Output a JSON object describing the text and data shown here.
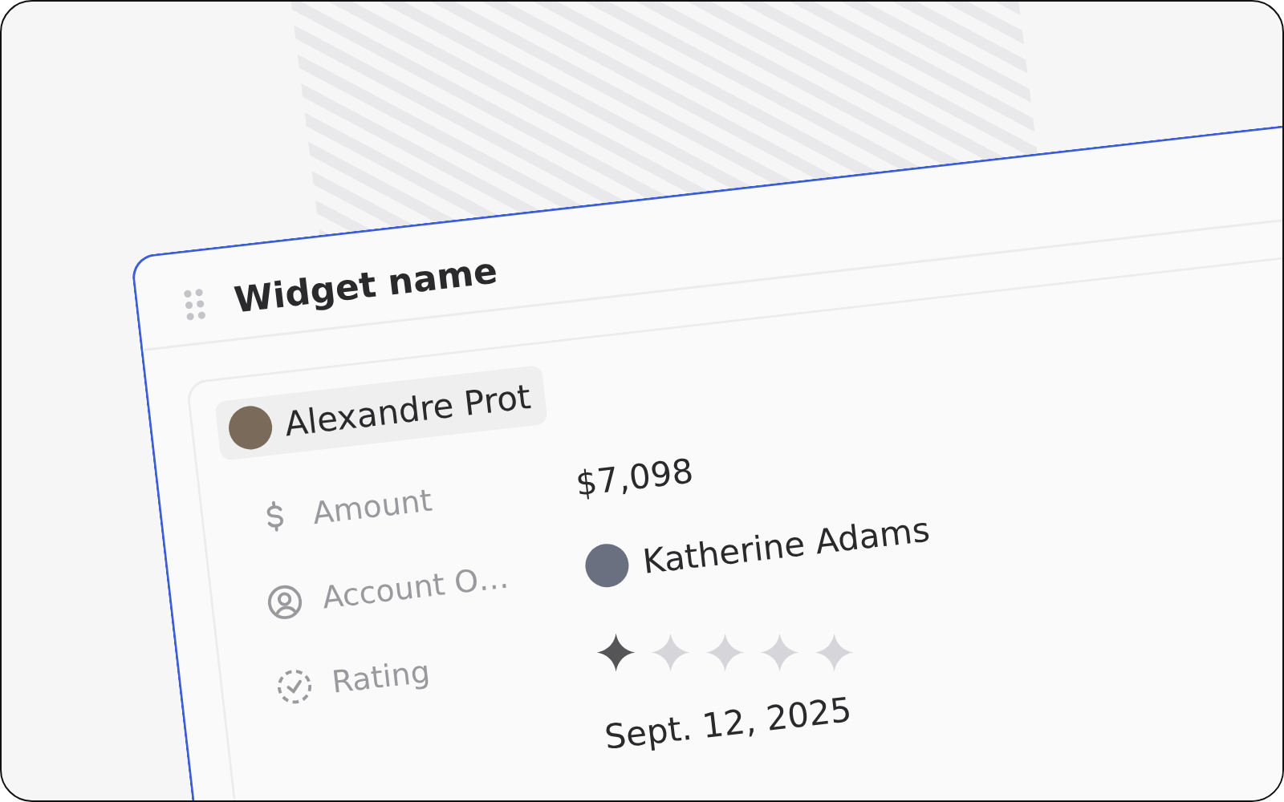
{
  "widget": {
    "title": "Widget name"
  },
  "record": {
    "name": "Alexandre Prot"
  },
  "fields": [
    {
      "kind": "amount",
      "label": "Amount",
      "value": "$7,098"
    },
    {
      "kind": "person",
      "label": "Account O…",
      "value": "Katherine Adams"
    },
    {
      "kind": "rating",
      "label": "Rating",
      "stars": 1
    },
    {
      "kind": "date",
      "value": "Sept. 12, 2025"
    }
  ]
}
